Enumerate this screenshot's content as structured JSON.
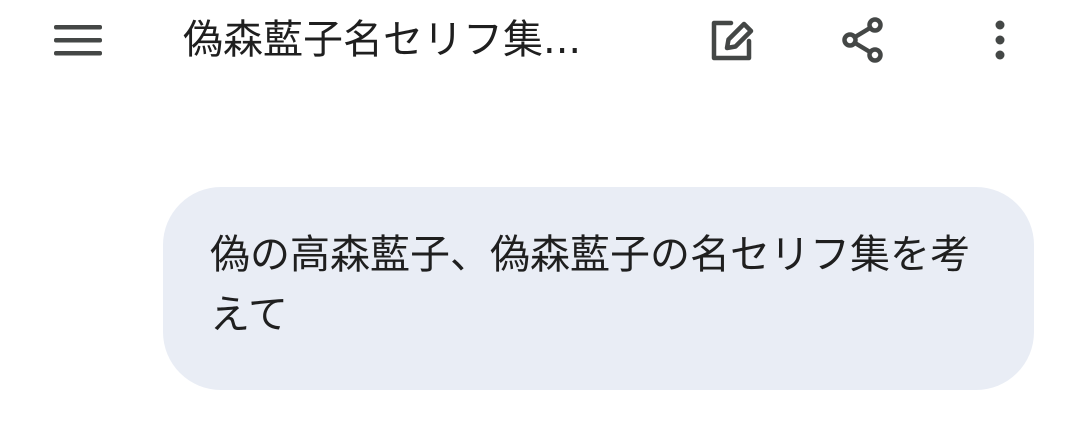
{
  "header": {
    "title": "偽森藍子名セリフ集...",
    "icons": {
      "menu": "menu-icon",
      "edit": "edit-icon",
      "share": "share-icon",
      "more": "more-vertical-icon"
    }
  },
  "conversation": {
    "user_message": "偽の高森藍子、偽森藍子の名セリフ集を考えて"
  },
  "colors": {
    "background": "#ffffff",
    "bubble": "#e9edf5",
    "text": "#1f1f1f",
    "icon": "#444746"
  }
}
